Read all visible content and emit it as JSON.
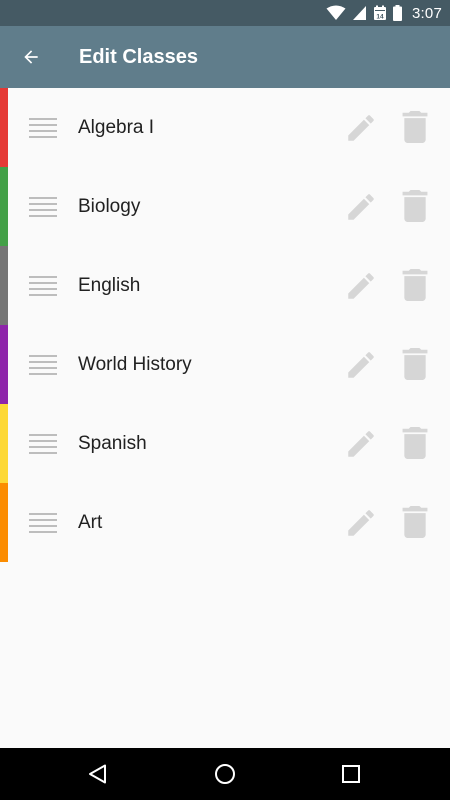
{
  "status_bar": {
    "time": "3:07",
    "calendar_day": "14"
  },
  "app_bar": {
    "title": "Edit Classes"
  },
  "colors": {
    "status_bar": "#455a64",
    "app_bar": "#607d8b",
    "list_background": "#fafafa",
    "icon_gray": "#d6d6d6"
  },
  "classes": [
    {
      "name": "Algebra I",
      "color": "#e53935"
    },
    {
      "name": "Biology",
      "color": "#43a047"
    },
    {
      "name": "English",
      "color": "#757575"
    },
    {
      "name": "World History",
      "color": "#8e24aa"
    },
    {
      "name": "Spanish",
      "color": "#fdd835"
    },
    {
      "name": "Art",
      "color": "#fb8c00"
    }
  ]
}
